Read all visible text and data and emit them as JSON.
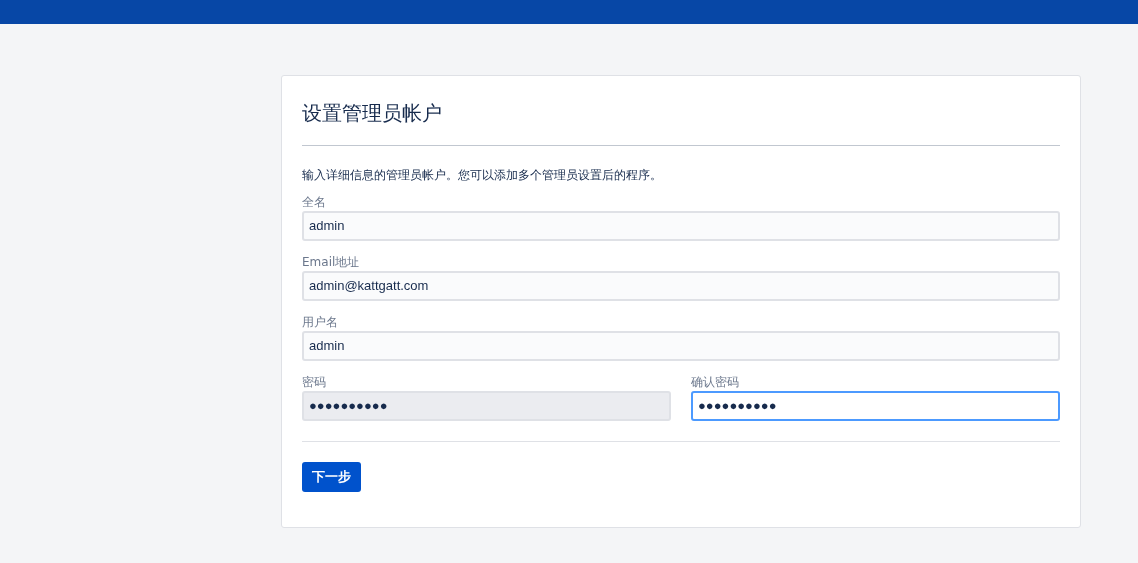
{
  "title": "设置管理员帐户",
  "description": "输入详细信息的管理员帐户。您可以添加多个管理员设置后的程序。",
  "rows": [
    {
      "fields": [
        {
          "label": "全名",
          "value": "admin",
          "focused": false,
          "highlighted": false
        }
      ]
    },
    {
      "fields": [
        {
          "label": "Email地址",
          "value": "admin@kattgatt.com",
          "focused": false,
          "highlighted": false
        }
      ]
    },
    {
      "fields": [
        {
          "label": "用户名",
          "value": "admin",
          "focused": false,
          "highlighted": false
        }
      ]
    },
    {
      "fields": [
        {
          "label": "密码",
          "value": "●●●●●●●●●●",
          "focused": false,
          "highlighted": true
        },
        {
          "label": "确认密码",
          "value": "●●●●●●●●●●",
          "focused": true,
          "highlighted": false
        }
      ]
    }
  ],
  "button": "下一步"
}
